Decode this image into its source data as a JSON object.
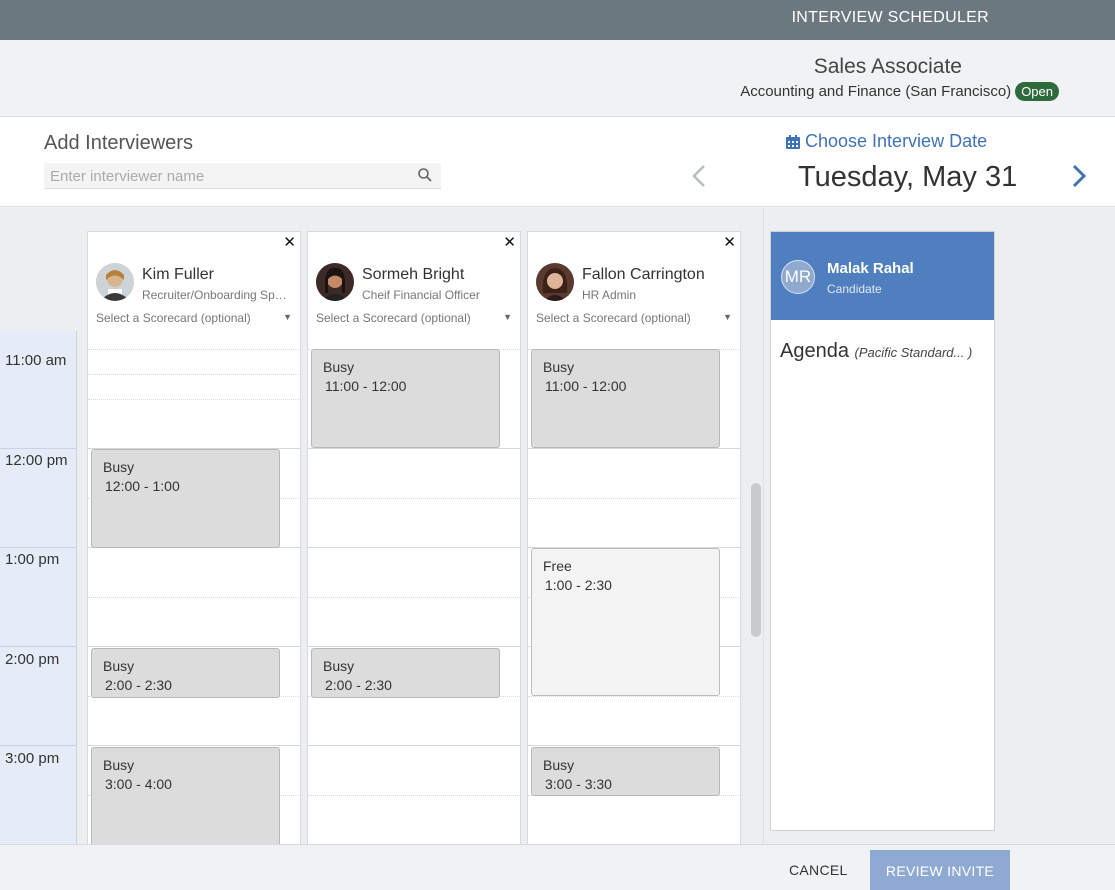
{
  "app": {
    "title": "INTERVIEW SCHEDULER"
  },
  "job": {
    "title": "Sales Associate",
    "department": "Accounting and Finance (San Francisco)",
    "status": "Open",
    "status_color": "#2e6b3c"
  },
  "interviewers": {
    "heading": "Add Interviewers",
    "search_placeholder": "Enter interviewer name"
  },
  "date": {
    "chooser_label": "Choose Interview Date",
    "current": "Tuesday, May 31"
  },
  "timeline": {
    "hours": [
      "11:00 am",
      "12:00 pm",
      "1:00 pm",
      "2:00 pm",
      "3:00 pm"
    ]
  },
  "columns": [
    {
      "name": "Kim Fuller",
      "role": "Recruiter/Onboarding Specialist",
      "scorecard": "Select a Scorecard (optional)",
      "blocks": [
        {
          "status": "Busy",
          "range": "12:00 - 1:00"
        },
        {
          "status": "Busy",
          "range": "2:00 - 2:30"
        },
        {
          "status": "Busy",
          "range": "3:00 - 4:00"
        }
      ]
    },
    {
      "name": "Sormeh Bright",
      "role": "Cheif Financial Officer",
      "scorecard": "Select a Scorecard (optional)",
      "blocks": [
        {
          "status": "Busy",
          "range": "11:00 - 12:00"
        },
        {
          "status": "Busy",
          "range": "2:00 - 2:30"
        }
      ]
    },
    {
      "name": "Fallon Carrington",
      "role": "HR Admin",
      "scorecard": "Select a Scorecard (optional)",
      "blocks": [
        {
          "status": "Busy",
          "range": "11:00 - 12:00"
        },
        {
          "status": "Free",
          "range": "1:00 - 2:30"
        },
        {
          "status": "Busy",
          "range": "3:00 - 3:30"
        }
      ]
    }
  ],
  "candidate": {
    "initials": "MR",
    "name": "Malak Rahal",
    "role": "Candidate",
    "agenda_label": "Agenda",
    "timezone": "(Pacific Standard... )",
    "header_color": "#4f7fbf"
  },
  "footer": {
    "cancel": "CANCEL",
    "review": "REVIEW INVITE"
  }
}
